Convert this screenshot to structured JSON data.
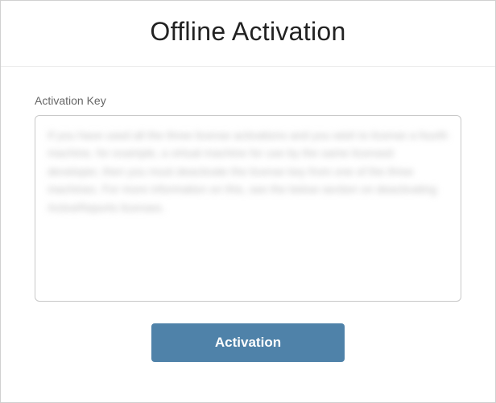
{
  "header": {
    "title": "Offline Activation"
  },
  "form": {
    "activationKey": {
      "label": "Activation Key",
      "value": "",
      "placeholder": ""
    },
    "blurredText": "If you have used all the three license activations and you wish to license a fourth machine, for example, a virtual machine for use by the same licensed developer, then you must deactivate the license key from one of the three machines. For more information on this, see the below section on deactivating ActiveReports licenses."
  },
  "actions": {
    "activation_label": "Activation"
  }
}
